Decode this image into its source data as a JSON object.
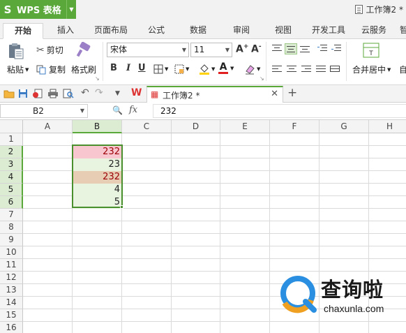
{
  "app": {
    "logo": "S",
    "name": "WPS 表格",
    "doc_title": "工作簿2 *"
  },
  "tabs": [
    "开始",
    "插入",
    "页面布局",
    "公式",
    "数据",
    "审阅",
    "视图",
    "开发工具",
    "云服务",
    "智"
  ],
  "ribbon": {
    "paste": "粘贴",
    "cut": "剪切",
    "copy": "复制",
    "format_painter": "格式刷",
    "font_name": "宋体",
    "font_size": "11",
    "bold": "B",
    "italic": "I",
    "underline": "U",
    "grow_font": "A⁺",
    "shrink_font": "A⁻",
    "merge_center": "合并居中",
    "wrap_partial": "自"
  },
  "doc_tab": {
    "name": "工作簿2 *"
  },
  "formula_bar": {
    "name_box": "B2",
    "fx": "fx",
    "value": "232"
  },
  "grid": {
    "columns": [
      "A",
      "B",
      "C",
      "D",
      "E",
      "F",
      "G",
      "H"
    ],
    "rows": [
      "1",
      "2",
      "3",
      "4",
      "5",
      "6",
      "7",
      "8",
      "9",
      "10",
      "11",
      "12",
      "13",
      "14",
      "15",
      "16"
    ],
    "cells": [
      {
        "ref": "B2",
        "value": "232",
        "bg": "#f7c6ce",
        "color": "#9c0006"
      },
      {
        "ref": "B3",
        "value": "23",
        "bg": "#e8f4e0",
        "color": "#222222"
      },
      {
        "ref": "B4",
        "value": "232",
        "bg": "#e6cdb4",
        "color": "#9c0006"
      },
      {
        "ref": "B5",
        "value": "4",
        "bg": "#e8f4e0",
        "color": "#222222"
      },
      {
        "ref": "B6",
        "value": "5",
        "bg": "#e8f4e0",
        "color": "#222222"
      }
    ],
    "selected_column": "B",
    "selected_rows": [
      "2",
      "3",
      "4",
      "5",
      "6"
    ]
  },
  "watermark": {
    "text": "查询啦",
    "domain": "chaxunla.com"
  },
  "colors": {
    "accent": "#5aa83a",
    "selection": "#4a8f2e"
  }
}
